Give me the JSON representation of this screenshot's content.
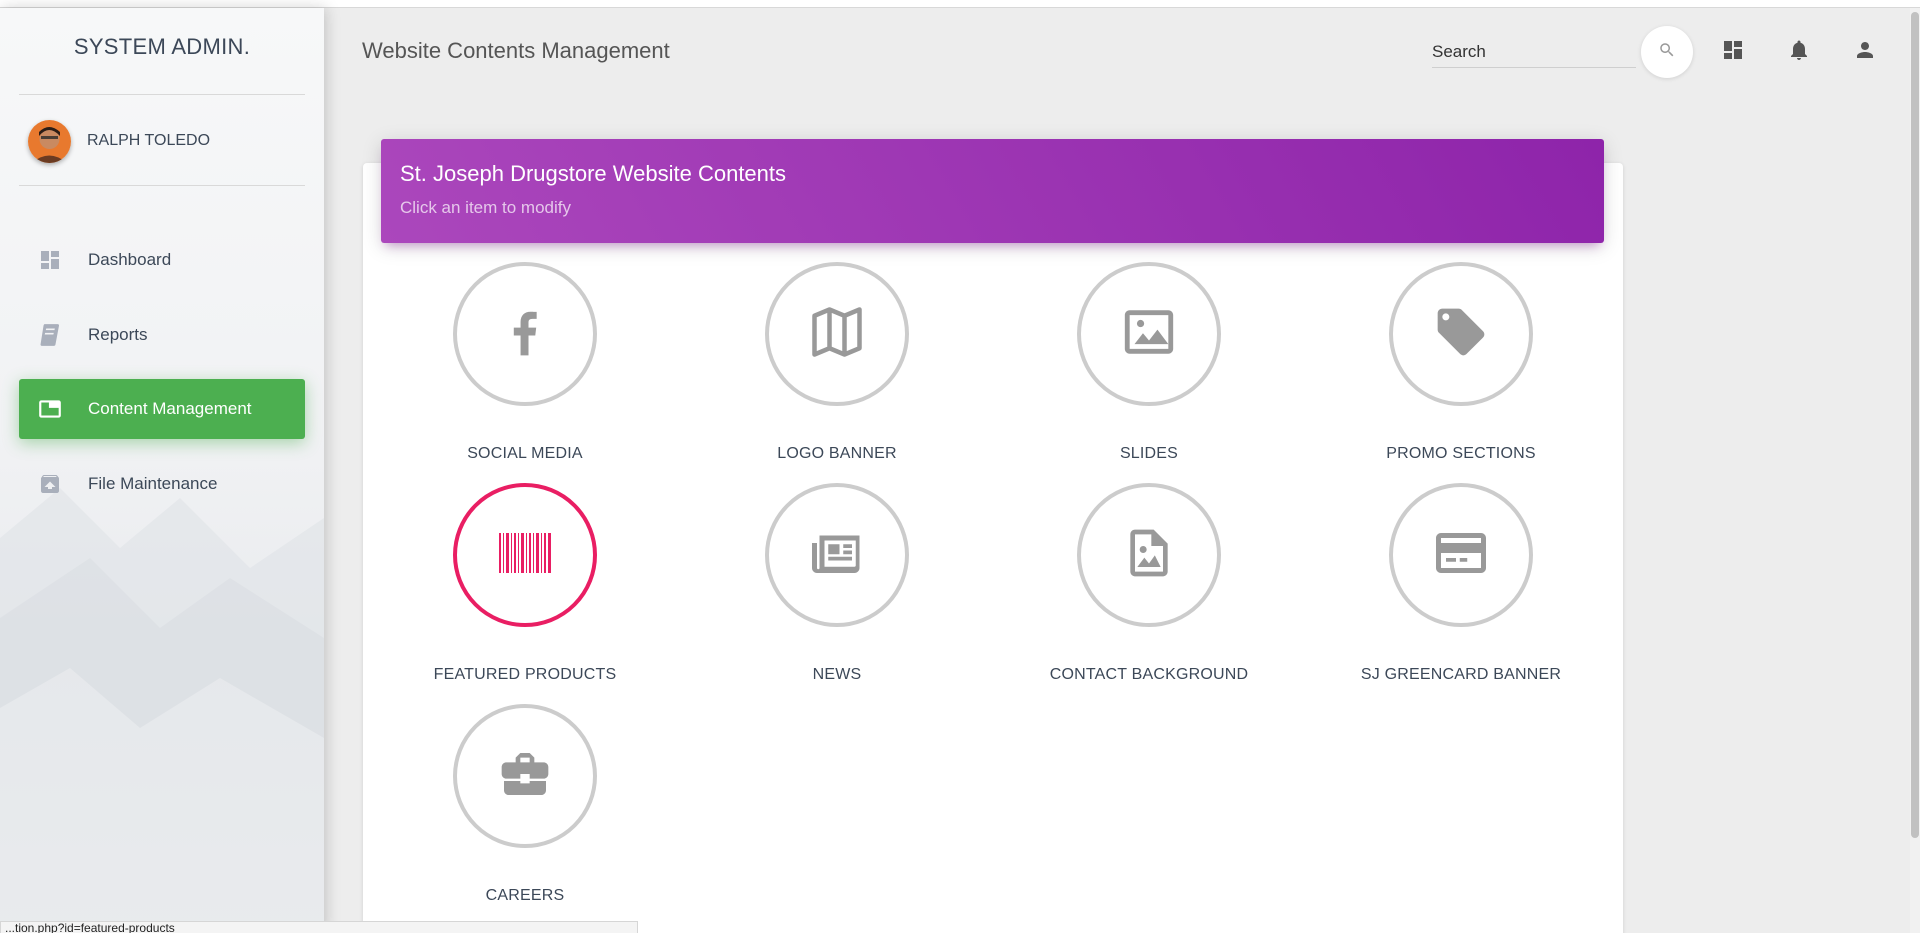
{
  "sidebar": {
    "brand": "SYSTEM ADMIN.",
    "user_name": "RALPH TOLEDO",
    "items": [
      {
        "label": "Dashboard",
        "icon": "dashboard-icon",
        "active": false
      },
      {
        "label": "Reports",
        "icon": "book-icon",
        "active": false
      },
      {
        "label": "Content Management",
        "icon": "web-window-icon",
        "active": true
      },
      {
        "label": "File Maintenance",
        "icon": "archive-icon",
        "active": false
      }
    ]
  },
  "header": {
    "title": "Website Contents Management",
    "search_placeholder": "Search",
    "icons": [
      "search-icon",
      "dashboard-icon",
      "notifications-icon",
      "person-icon"
    ]
  },
  "card": {
    "title": "St. Joseph Drugstore Website Contents",
    "subtitle": "Click an item to modify",
    "accent_color": "#9c27b0",
    "items": [
      {
        "label": "SOCIAL MEDIA",
        "icon": "facebook-icon"
      },
      {
        "label": "LOGO BANNER",
        "icon": "map-icon"
      },
      {
        "label": "SLIDES",
        "icon": "image-icon"
      },
      {
        "label": "PROMO SECTIONS",
        "icon": "tag-icon"
      },
      {
        "label": "FEATURED PRODUCTS",
        "icon": "barcode-icon",
        "selected": true
      },
      {
        "label": "NEWS",
        "icon": "newspaper-icon"
      },
      {
        "label": "CONTACT BACKGROUND",
        "icon": "image-file-icon"
      },
      {
        "label": "SJ GREENCARD BANNER",
        "icon": "credit-card-icon"
      },
      {
        "label": "CAREERS",
        "icon": "briefcase-icon"
      }
    ]
  },
  "colors": {
    "active_nav": "#4caf50",
    "selected_ring": "#e91e63",
    "icon_gray": "#999999"
  },
  "statusbar": {
    "text": "...tion.php?id=featured-products"
  }
}
